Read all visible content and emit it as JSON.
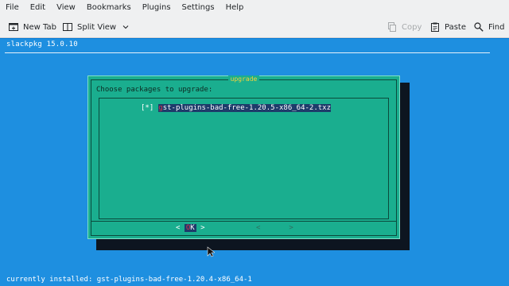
{
  "menubar": {
    "items": [
      "File",
      "Edit",
      "View",
      "Bookmarks",
      "Plugins",
      "Settings",
      "Help"
    ]
  },
  "toolbar": {
    "new_tab": "New Tab",
    "split_view": "Split View",
    "copy": "Copy",
    "paste": "Paste",
    "find": "Find"
  },
  "terminal": {
    "title": "slackpkg 15.0.10",
    "dialog": {
      "title": "upgrade",
      "prompt": "Choose packages to upgrade:",
      "items": [
        {
          "checkbox": "[*]",
          "first_char": "g",
          "rest": "st-plugins-bad-free-1.20.5-x86_64-2.txz"
        }
      ],
      "ok": {
        "left": "<",
        "hotkey": "O",
        "rest": "K",
        "right": ">"
      },
      "cancel": {
        "left": "<",
        "right": ">"
      }
    },
    "status_line": "currently installed: gst-plugins-bad-free-1.20.4-x86_64-1"
  },
  "colors": {
    "terminal_bg": "#1e8fe0",
    "dialog_bg": "#1aae8f",
    "title_fg": "#f3d23a",
    "selection_bg": "#1e3b6a",
    "hotkey_fg": "#d6374b"
  }
}
